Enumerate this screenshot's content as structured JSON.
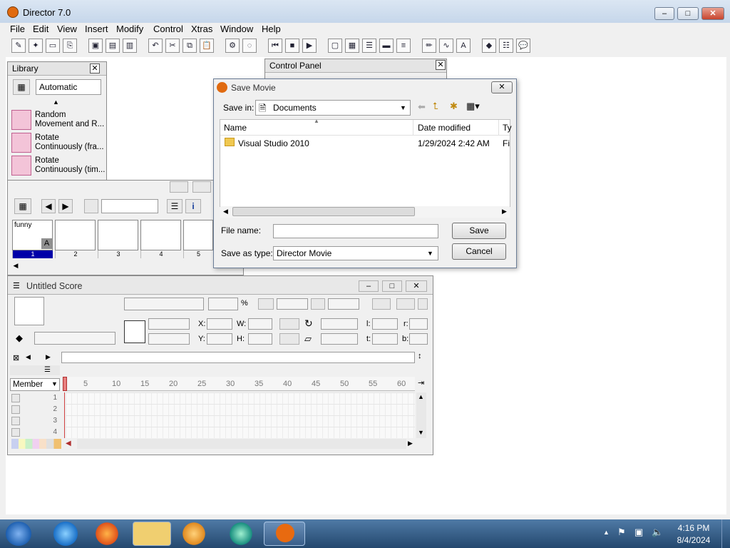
{
  "window": {
    "title": "Director 7.0",
    "min": "–",
    "max": "□",
    "close": "✕"
  },
  "menu": [
    "File",
    "Edit",
    "View",
    "Insert",
    "Modify",
    "Control",
    "Xtras",
    "Window",
    "Help"
  ],
  "library": {
    "title": "Library",
    "filter": "Automatic",
    "items": [
      {
        "line1": "Random",
        "line2": "Movement and R..."
      },
      {
        "line1": "Rotate",
        "line2": "Continuously (fra..."
      },
      {
        "line1": "Rotate",
        "line2": "Continuously (tim..."
      }
    ]
  },
  "control_panel": {
    "title": "Control Panel"
  },
  "cast": {
    "member_name": "funny",
    "member_badge": "A",
    "numbers": [
      "1",
      "2",
      "3",
      "4",
      "5"
    ]
  },
  "dialog": {
    "title": "Save Movie",
    "save_in_label": "Save in:",
    "save_in_value": "Documents",
    "col_name": "Name",
    "col_date": "Date modified",
    "col_type": "Ty",
    "row": {
      "name": "Visual Studio 2010",
      "date": "1/29/2024 2:42 AM",
      "type": "Fi"
    },
    "file_name_label": "File name:",
    "file_name_value": "",
    "save_type_label": "Save as type:",
    "save_type_value": "Director Movie",
    "save_button": "Save",
    "cancel_button": "Cancel"
  },
  "score": {
    "title": "Untitled Score",
    "percent": "%",
    "x_label": "X:",
    "y_label": "Y:",
    "w_label": "W:",
    "h_label": "H:",
    "l_label": "l:",
    "r_label": "r:",
    "t_label": "t:",
    "b_label": "b:",
    "channel_mode": "Member",
    "frame_ticks": [
      "5",
      "10",
      "15",
      "20",
      "25",
      "30",
      "35",
      "40",
      "45",
      "50",
      "55",
      "60"
    ],
    "channels": [
      "1",
      "2",
      "3",
      "4"
    ]
  },
  "tray": {
    "time": "4:16 PM",
    "date": "8/4/2024"
  },
  "colors": {
    "accent": "#0a2a9a",
    "selected": "#0000a8",
    "taskbar": "#24486e"
  }
}
